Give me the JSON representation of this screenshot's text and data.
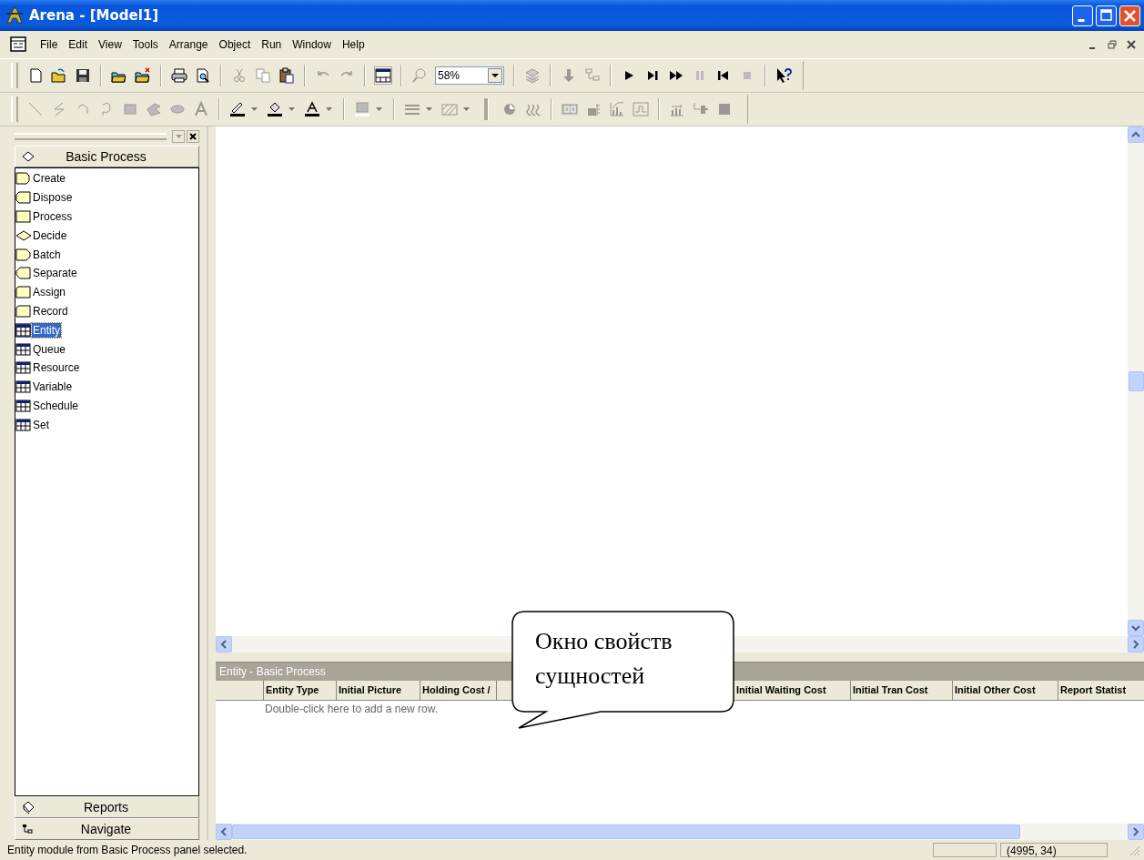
{
  "window": {
    "title": "Arena - [Model1]"
  },
  "menu": [
    "File",
    "Edit",
    "View",
    "Tools",
    "Arrange",
    "Object",
    "Run",
    "Window",
    "Help"
  ],
  "toolbar": {
    "zoom": "58%"
  },
  "project_bar": {
    "panels": [
      {
        "label": "Basic Process",
        "expanded": true
      },
      {
        "label": "Reports",
        "expanded": false
      },
      {
        "label": "Navigate",
        "expanded": false
      }
    ],
    "modules": [
      {
        "label": "Create",
        "kind": "create",
        "selected": false
      },
      {
        "label": "Dispose",
        "kind": "dispose",
        "selected": false
      },
      {
        "label": "Process",
        "kind": "process",
        "selected": false
      },
      {
        "label": "Decide",
        "kind": "decide",
        "selected": false
      },
      {
        "label": "Batch",
        "kind": "batch",
        "selected": false
      },
      {
        "label": "Separate",
        "kind": "separate",
        "selected": false
      },
      {
        "label": "Assign",
        "kind": "assign",
        "selected": false
      },
      {
        "label": "Record",
        "kind": "record",
        "selected": false
      },
      {
        "label": "Entity",
        "kind": "data",
        "selected": true
      },
      {
        "label": "Queue",
        "kind": "data",
        "selected": false
      },
      {
        "label": "Resource",
        "kind": "data",
        "selected": false
      },
      {
        "label": "Variable",
        "kind": "data",
        "selected": false
      },
      {
        "label": "Schedule",
        "kind": "data",
        "selected": false
      },
      {
        "label": "Set",
        "kind": "data",
        "selected": false
      }
    ]
  },
  "callout": {
    "text": "Окно свойств сущностей"
  },
  "spreadsheet": {
    "title": "Entity - Basic Process",
    "columns": [
      "Entity Type",
      "Initial Picture",
      "Holding Cost /",
      "Initial Waiting Cost",
      "Initial Tran Cost",
      "Initial Other Cost",
      "Report Statist"
    ],
    "hint": "Double-click here to add a new row."
  },
  "status_bar": {
    "message": "Entity module from Basic Process panel selected.",
    "coordinates": "(4995, 34)"
  }
}
